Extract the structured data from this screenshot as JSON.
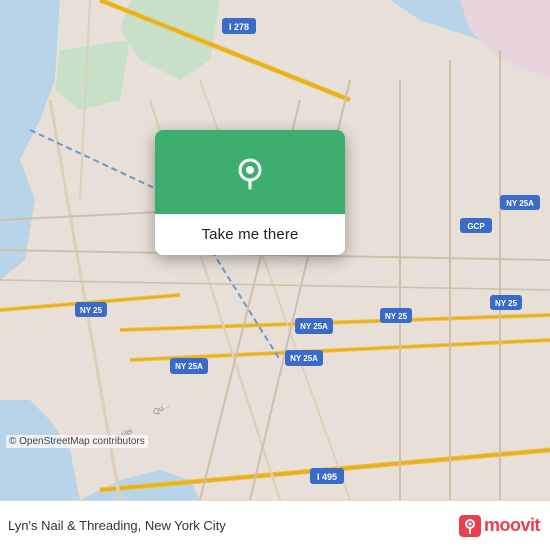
{
  "map": {
    "credit": "© OpenStreetMap contributors",
    "bg_color": "#e8e0d8"
  },
  "popup": {
    "button_label": "Take me there",
    "pin_icon": "location-pin-icon",
    "header_color": "#3dae6e"
  },
  "bottom_bar": {
    "location_name": "Lyn's Nail & Threading, New York City",
    "moovit_label": "moovit"
  }
}
